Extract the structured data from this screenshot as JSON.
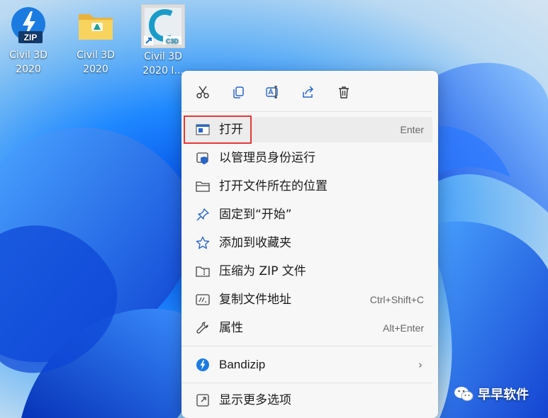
{
  "desktop": {
    "icons": [
      {
        "line1": "Civil 3D",
        "line2": "2020",
        "badge": "ZIP",
        "icon": "bandizip-zip-icon"
      },
      {
        "line1": "Civil 3D",
        "line2": "2020",
        "icon": "folder-icon"
      },
      {
        "line1": "Civil 3D",
        "line2": "2020 I...",
        "badge": "C3D",
        "icon": "autodesk-civil3d-shortcut-icon"
      }
    ]
  },
  "context_menu": {
    "toolbar": [
      {
        "name": "cut",
        "icon": "scissors-icon"
      },
      {
        "name": "copy",
        "icon": "copy-icon"
      },
      {
        "name": "rename",
        "icon": "rename-icon"
      },
      {
        "name": "share",
        "icon": "share-icon"
      },
      {
        "name": "delete",
        "icon": "trash-icon"
      }
    ],
    "items": [
      {
        "label": "打开",
        "shortcut": "Enter",
        "icon": "app-window-icon"
      },
      {
        "label": "以管理员身份运行",
        "icon": "shield-icon"
      },
      {
        "label": "打开文件所在的位置",
        "icon": "folder-outline-icon"
      },
      {
        "label": "固定到“开始”",
        "icon": "pin-icon"
      },
      {
        "label": "添加到收藏夹",
        "icon": "star-icon"
      },
      {
        "label": "压缩为 ZIP 文件",
        "icon": "zip-folder-icon"
      },
      {
        "label": "复制文件地址",
        "shortcut": "Ctrl+Shift+C",
        "icon": "copy-path-icon"
      },
      {
        "label": "属性",
        "shortcut": "Alt+Enter",
        "icon": "wrench-icon"
      },
      {
        "label": "Bandizip",
        "icon": "bandizip-icon",
        "chevron": "›"
      },
      {
        "label": "显示更多选项",
        "icon": "expand-icon"
      }
    ]
  },
  "watermark": {
    "text": "早早软件",
    "icon": "wechat-icon"
  },
  "colors": {
    "highlight": "#e53935",
    "accent": "#0067c0",
    "menu_bg": "#f7f7f8"
  }
}
